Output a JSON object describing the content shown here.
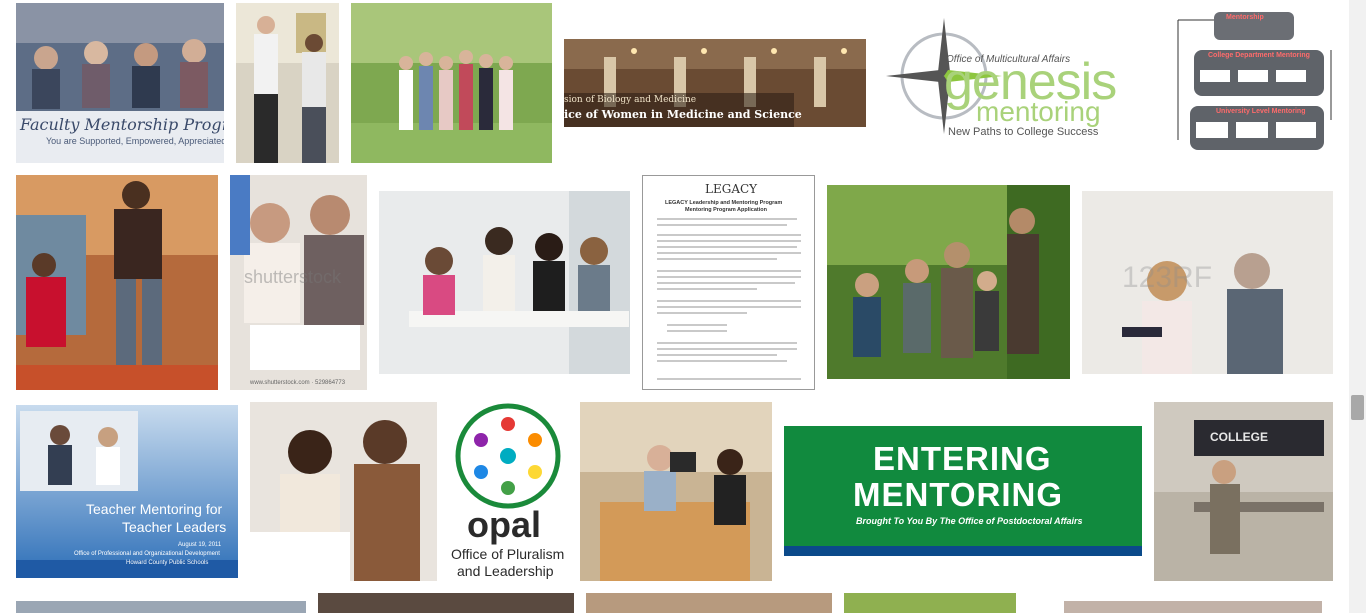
{
  "results": [
    {
      "id": "r1",
      "overlay": {
        "title": "Faculty Mentorship Program",
        "subtitle": "You are Supported, Empowered, Appreciated"
      }
    },
    {
      "id": "r2"
    },
    {
      "id": "r3"
    },
    {
      "id": "r4",
      "overlay": {
        "line1": "sion of Biology and Medicine",
        "line2": "ice of Women in Medicine and Science"
      }
    },
    {
      "id": "r5",
      "overlay": {
        "small": "Office of Multicultural Affairs",
        "big1": "genesis",
        "big2": "mentoring",
        "tag": "New Paths to College Success"
      }
    },
    {
      "id": "r6",
      "overlay": {
        "box1": "Mentorship",
        "box2": "College Department Mentoring",
        "box3": "University Level Mentoring"
      }
    },
    {
      "id": "r7"
    },
    {
      "id": "r8",
      "overlay": {
        "watermark": "shutterstock",
        "caption": "www.shutterstock.com · 529864773"
      }
    },
    {
      "id": "r9"
    },
    {
      "id": "r10",
      "overlay": {
        "logo": "LEGACY",
        "title": "LEGACY Leadership and Mentoring Program",
        "subtitle": "Mentoring Program Application"
      }
    },
    {
      "id": "r11"
    },
    {
      "id": "r12",
      "overlay": {
        "watermark": "123RF"
      }
    },
    {
      "id": "r13",
      "overlay": {
        "title1": "Teacher Mentoring for",
        "title2": "Teacher Leaders",
        "date": "August 19, 2011",
        "org1": "Office of Professional and Organizational Development",
        "org2": "Howard County Public Schools"
      }
    },
    {
      "id": "r14"
    },
    {
      "id": "r15",
      "overlay": {
        "big": "opal",
        "line1": "Office of Pluralism",
        "line2": "and Leadership"
      }
    },
    {
      "id": "r16"
    },
    {
      "id": "r17",
      "overlay": {
        "line1": "ENTERING",
        "line2": "MENTORING",
        "line3": "Brought To You By The Office of Postdoctoral Affairs"
      }
    },
    {
      "id": "r18",
      "overlay": {
        "board": "COLLEGE"
      }
    },
    {
      "id": "r19"
    },
    {
      "id": "r20"
    },
    {
      "id": "r21"
    },
    {
      "id": "r22"
    },
    {
      "id": "r23"
    }
  ],
  "colors": {
    "background": "#ffffff",
    "scrollbar_track": "#f1f1f1",
    "scrollbar_thumb": "#a8a8a8"
  }
}
